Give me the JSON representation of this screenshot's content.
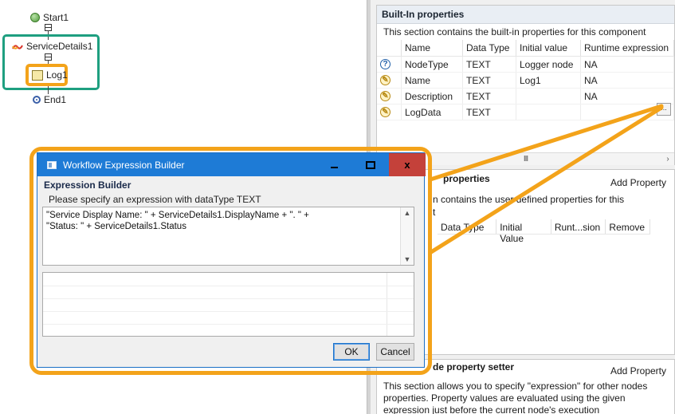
{
  "workflow": {
    "nodes": [
      {
        "label": "Start1",
        "icon": "start-circle-icon"
      },
      {
        "label": "ServiceDetails1",
        "icon": "service-icon"
      },
      {
        "label": "Log1",
        "icon": "log-note-icon"
      },
      {
        "label": "End1",
        "icon": "end-circle-icon"
      }
    ],
    "highlight_colors": {
      "service_group": "#1e9f80",
      "log_node": "#f3a31a"
    }
  },
  "builtin": {
    "title": "Built-In properties",
    "description": "This section contains the built-in properties for this component",
    "columns": [
      "Name",
      "Data Type",
      "Initial value",
      "Runtime expression"
    ],
    "rows": [
      {
        "icon": "help-icon",
        "name": "NodeType",
        "type": "TEXT",
        "initial": "Logger node",
        "runtime": "NA"
      },
      {
        "icon": "edit-icon",
        "name": "Name",
        "type": "TEXT",
        "initial": "Log1",
        "runtime": "NA"
      },
      {
        "icon": "edit-icon",
        "name": "Description",
        "type": "TEXT",
        "initial": "",
        "runtime": "NA"
      },
      {
        "icon": "edit-icon",
        "name": "LogData",
        "type": "TEXT",
        "initial": "",
        "runtime": ""
      }
    ],
    "ellipsis_label": "...",
    "scroll_thumb": "III"
  },
  "userdefined": {
    "title_visible": "properties",
    "add_label": "Add Property",
    "description_visible": "n contains the user defined properties for this",
    "description_line2": "t",
    "columns": [
      "Data Type",
      "Initial Value",
      "Runt...sion",
      "Remove"
    ]
  },
  "setter": {
    "title_visible": "de property setter",
    "add_label": "Add Property",
    "description": "This section allows you to specify \"expression\" for other nodes properties. Property values are evaluated using the given expression just before the current node's execution"
  },
  "dialog": {
    "title": "Workflow Expression Builder",
    "section_title": "Expression Builder",
    "hint": "Please specify an expression with dataType TEXT",
    "expression": "\"Service Display Name: \" + ServiceDetails1.DisplayName + \". \" +\n\"Status: \" + ServiceDetails1.Status",
    "ok_label": "OK",
    "cancel_label": "Cancel",
    "close_glyph": "x",
    "titlebar_color": "#1e7bd6",
    "outline_color": "#f3a31a"
  }
}
